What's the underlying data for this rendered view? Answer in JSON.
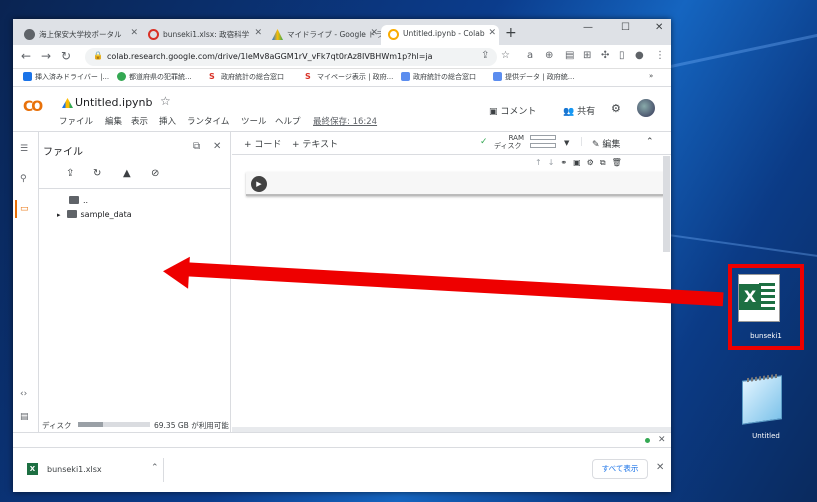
{
  "browser": {
    "tabs": [
      {
        "label": "海上保安大学校ポータル",
        "icon": "globe-icon"
      },
      {
        "label": "bunseki1.xlsx: 政宿科学",
        "icon": "loading-icon"
      },
      {
        "label": "マイドライブ - Google ドラ",
        "icon": "drive-icon"
      },
      {
        "label": "Untitled.ipynb - Colab",
        "icon": "colab-icon"
      }
    ],
    "new_tab": "+",
    "url": "colab.research.google.com/drive/1leMv8aGGM1rV_vFk7qt0rAz8IVBHWm1p?hl=ja",
    "bookmarks": [
      "挿入済みドライバー |...",
      "都道府県の犯罪統...",
      "政府統計の総合窓口",
      "マイページ表示 | 政府...",
      "政府統計の総合窓口",
      "提供データ | 政府統..."
    ]
  },
  "colab": {
    "logo": "CO",
    "title": "Untitled.ipynb",
    "menus": [
      "ファイル",
      "編集",
      "表示",
      "挿入",
      "ランタイム",
      "ツール",
      "ヘルプ"
    ],
    "last_saved": "最終保存: 16:24",
    "comment": "コメント",
    "share": "共有",
    "files_title": "ファイル",
    "parent_dir": "..",
    "folder": "sample_data",
    "disk_label": "ディスク",
    "disk_free": "69.35 GB が利用可能",
    "disk_used_fraction": 0.35,
    "add_code": "+ コード",
    "add_text": "+ テキスト",
    "ram_label": "RAM",
    "disk_short": "ディスク",
    "edit": "編集"
  },
  "downloads": {
    "file": "bunseki1.xlsx",
    "show_all": "すべて表示"
  },
  "desktop": {
    "excel_icon_label": "bunseki1",
    "excel_letter": "X",
    "notepad_label": "Untitled"
  },
  "colors": {
    "accent": "#1a73e8",
    "arrow": "#ee0000",
    "excel": "#1d6f42"
  }
}
